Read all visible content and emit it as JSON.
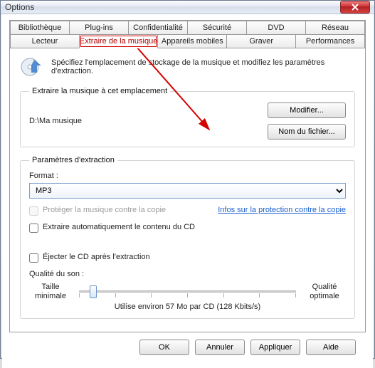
{
  "window": {
    "title": "Options"
  },
  "tabs_row1": [
    "Bibliothèque",
    "Plug-ins",
    "Confidentialité",
    "Sécurité",
    "DVD",
    "Réseau"
  ],
  "tabs_row2": [
    "Lecteur",
    "Extraire de la musique",
    "Appareils mobiles",
    "Graver",
    "Performances"
  ],
  "active_tab_index_row2": 1,
  "header": {
    "text": "Spécifiez l'emplacement de stockage de la musique et modifiez les paramètres d'extraction."
  },
  "location": {
    "legend": "Extraire la musique à cet emplacement",
    "path": "D:\\Ma musique",
    "modify_btn": "Modifier...",
    "filename_btn": "Nom du fichier..."
  },
  "params": {
    "legend": "Paramètres d'extraction",
    "format_label": "Format :",
    "format_value": "MP3",
    "copy_protect": "Protéger la musique contre la copie",
    "copy_link": "Infos sur la protection contre la copie",
    "auto_rip": "Extraire automatiquement le contenu du CD",
    "eject": "Éjecter le CD après l'extraction",
    "quality_label": "Qualité du son :",
    "size_min_1": "Taille",
    "size_min_2": "minimale",
    "qual_max_1": "Qualité",
    "qual_max_2": "optimale",
    "usage": "Utilise environ 57 Mo par CD (128 Kbits/s)"
  },
  "footer": {
    "ok": "OK",
    "cancel": "Annuler",
    "apply": "Appliquer",
    "help": "Aide"
  },
  "slider_pos_pct": 5
}
